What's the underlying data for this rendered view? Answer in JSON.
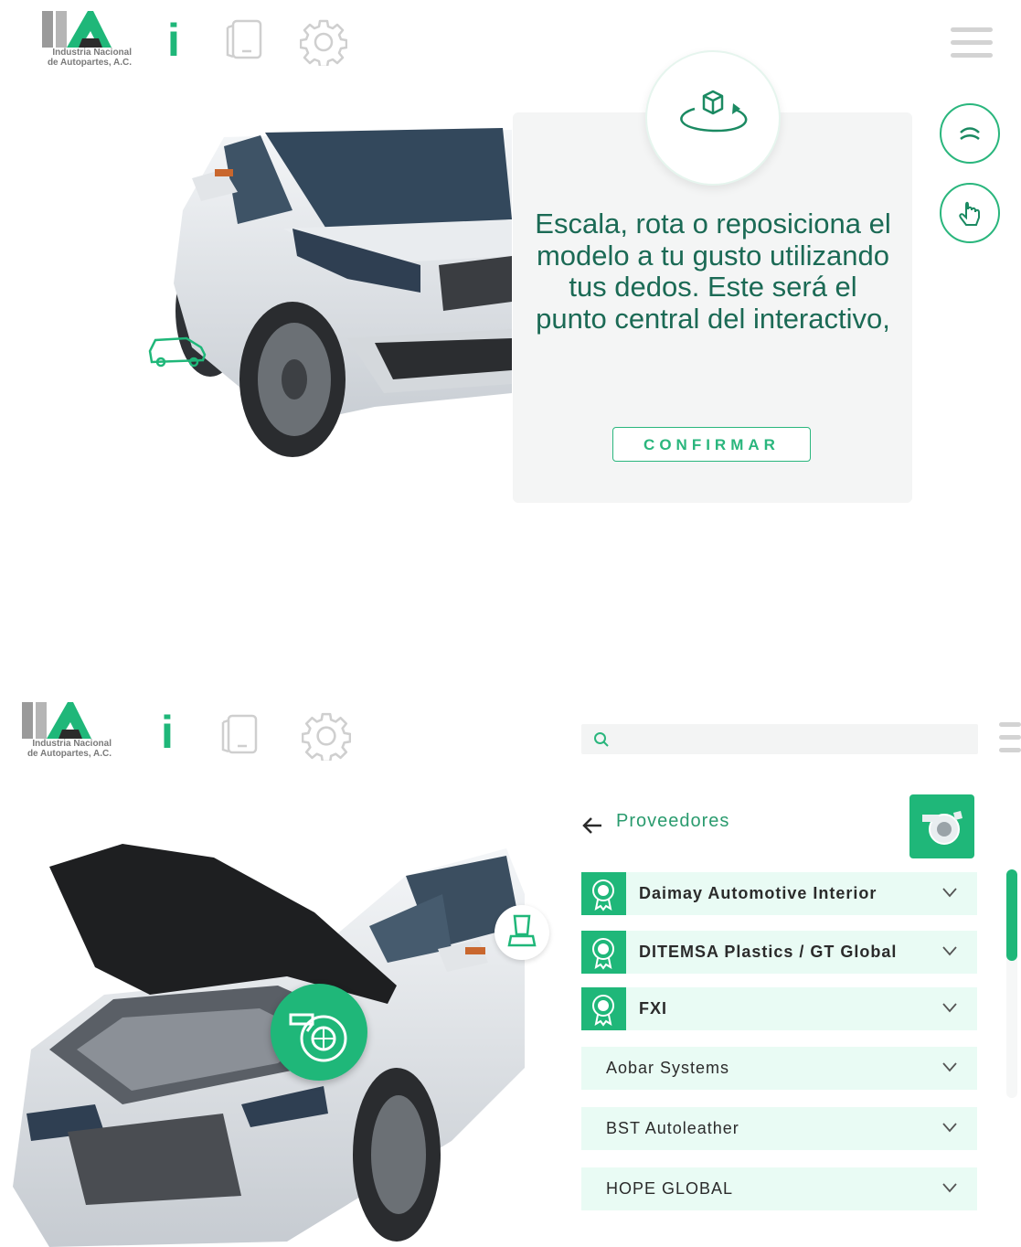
{
  "logo": {
    "line1": "Industria Nacional",
    "line2": "de Autopartes, A.C."
  },
  "nav": {
    "info_glyph": "i",
    "icons": [
      "info-icon",
      "tablet-icon",
      "gear-icon",
      "menu-icon"
    ]
  },
  "tutorial": {
    "icon": "rotate-cube-icon",
    "text": "Escala, rota o reposiciona el modelo a tu gusto utilizando tus dedos. Este será el punto central del interactivo,",
    "confirm_label": "CONFIRMAR"
  },
  "side_buttons": [
    "swipe-icon",
    "hand-pointer-icon"
  ],
  "search": {
    "placeholder": ""
  },
  "providers": {
    "title": "Proveedores",
    "category_icon": "turbo-icon",
    "items": [
      {
        "label": "Daimay Automotive Interior",
        "featured": true
      },
      {
        "label": "DITEMSA Plastics / GT Global",
        "featured": true
      },
      {
        "label": "FXI",
        "featured": true
      },
      {
        "label": "Aobar Systems",
        "featured": false
      },
      {
        "label": "BST Autoleather",
        "featured": false
      },
      {
        "label": "HOPE GLOBAL",
        "featured": false
      }
    ]
  },
  "colors": {
    "accent": "#1fb779",
    "panel_bg": "#f4f5f5",
    "list_bg": "#e9fbf4",
    "text_dark": "#1b6a55"
  }
}
